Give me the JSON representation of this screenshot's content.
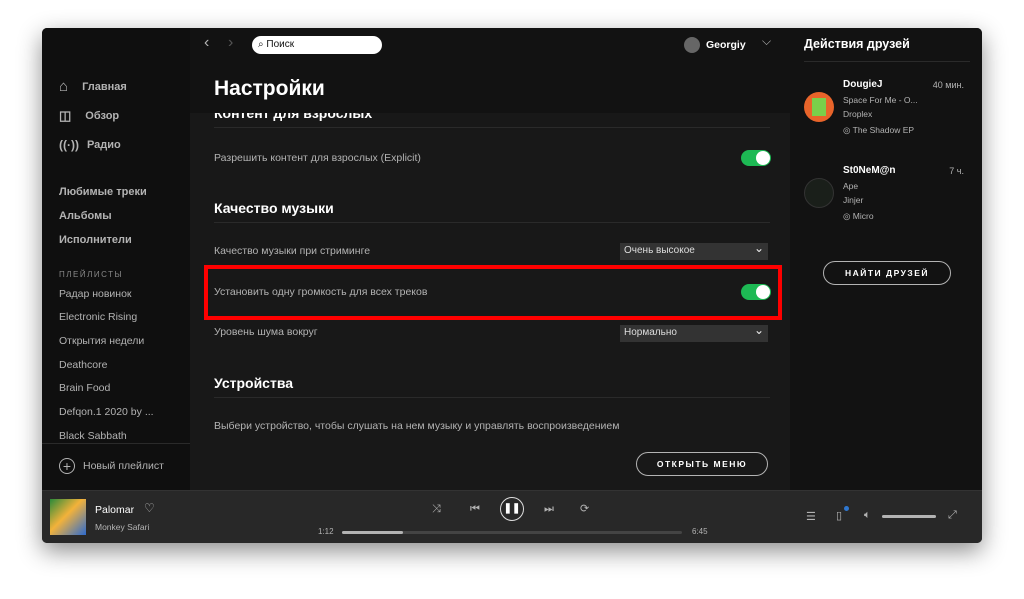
{
  "header": {
    "search_placeholder": "Поиск",
    "user": "Georgiy",
    "title": "Настройки"
  },
  "sidebar": {
    "nav": [
      {
        "label": "Главная",
        "icon": "home-icon"
      },
      {
        "label": "Обзор",
        "icon": "browse-icon"
      },
      {
        "label": "Радио",
        "icon": "radio-icon"
      }
    ],
    "library": [
      "Любимые треки",
      "Альбомы",
      "Исполнители"
    ],
    "playlists_title": "ПЛЕЙЛИСТЫ",
    "playlists": [
      "Радар новинок",
      "Electronic Rising",
      "Открытия недели",
      "Deathcore",
      "Brain Food",
      "Defqon.1 2020 by ...",
      "Black Sabbath"
    ],
    "new_playlist": "Новый плейлист"
  },
  "settings": {
    "explicit_title": "Контент для взрослых",
    "explicit_label": "Разрешить контент для взрослых (Explicit)",
    "explicit_on": true,
    "quality_title": "Качество музыки",
    "stream_label": "Качество музыки при стриминге",
    "stream_value": "Очень высокое",
    "normalize_label": "Установить одну громкость для всех треков",
    "normalize_on": true,
    "noise_label": "Уровень шума вокруг",
    "noise_value": "Нормально",
    "devices_title": "Устройства",
    "devices_label": "Выбери устройство, чтобы слушать на нем музыку и управлять воспроизведением",
    "open_menu": "ОТКРЫТЬ МЕНЮ"
  },
  "friends": {
    "title": "Действия друзей",
    "items": [
      {
        "name": "DougieJ",
        "time": "40 мин.",
        "track": "Space For Me - O...",
        "artist": "Droplex",
        "album": "The Shadow EP"
      },
      {
        "name": "St0NeM@n",
        "time": "7 ч.",
        "track": "Ape",
        "artist": "Jinjer",
        "album": "Micro"
      }
    ],
    "find": "НАЙТИ ДРУЗЕЙ"
  },
  "player": {
    "track": "Palomar",
    "artist": "Monkey Safari",
    "elapsed": "1:12",
    "total": "6:45",
    "progress": 0.18,
    "volume": 1.0
  },
  "colors": {
    "accent": "#1db954",
    "highlight": "#ff0000"
  }
}
